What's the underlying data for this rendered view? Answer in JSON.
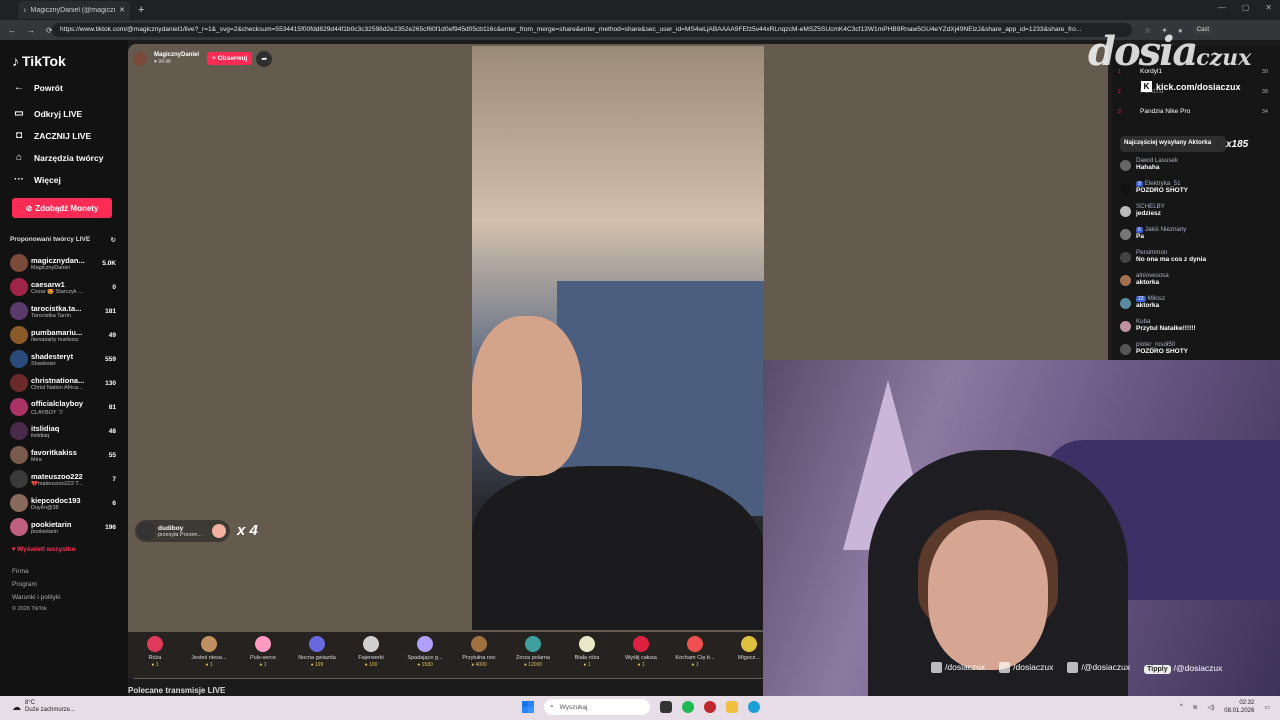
{
  "browser": {
    "tab_title": "MagicznyDaniel (@magiczny...",
    "url": "https://www.tiktok.com/@magicznydaniel1/live?_r=1&_svg=2&checksum=5534415f00fdd829d44f1b0c3c32598d2e2352e265cf60f1d0ef945d05cb116c&enter_from_merge=share&enter_method=share&sec_user_id=MS4wLjABAAAA9FEfz5v44xRLnqzcM-eMSZ5SUcmK4C3cf13W1mPHB9Rnaw5GU4eYZdXj49NElzJ&share_app_id=1233&share_fro...",
    "cast_label": "Cast"
  },
  "sidebar": {
    "logo": "TikTok",
    "back": "Powrót",
    "nav": [
      "Odkryj LIVE",
      "ZACZNIJ LIVE",
      "Narzędzia twórcy",
      "Więcej"
    ],
    "coins_button": "Zdobądź Monety",
    "suggested_title": "Proponowani twórcy LIVE",
    "creators": [
      {
        "name": "magicznydan...",
        "sub": "MagicznyDaniel",
        "count": "5.0K",
        "color": "#7a4a3a"
      },
      {
        "name": "caesarw1",
        "sub": "Cezar 😍 Starczyk ...",
        "count": "0",
        "color": "#a0234a"
      },
      {
        "name": "tarocistka.ta...",
        "sub": "Tarocistka Tarrin",
        "count": "181",
        "color": "#5a3a6a"
      },
      {
        "name": "pumbamariu...",
        "sub": "nienażarty markosz",
        "count": "49",
        "color": "#8a5a2a"
      },
      {
        "name": "shadesteryt",
        "sub": "Shadester",
        "count": "559",
        "color": "#2a4a7a"
      },
      {
        "name": "christnationa...",
        "sub": "Christ Nation Africa...",
        "count": "130",
        "color": "#6a2a2a"
      },
      {
        "name": "officialclayboy",
        "sub": "CLAYBOY ツ",
        "count": "81",
        "color": "#aa3366"
      },
      {
        "name": "itslidiaq",
        "sub": "itslidiaq",
        "count": "48",
        "color": "#4a2a4a"
      },
      {
        "name": "favoritkakiss",
        "sub": "Mira",
        "count": "55",
        "color": "#7a5a4a"
      },
      {
        "name": "mateuszoo222",
        "sub": "💔mateuszoo222 T...",
        "count": "7",
        "color": "#3a3a3a"
      },
      {
        "name": "kiepcodoc193",
        "sub": "Duyên@38",
        "count": "6",
        "color": "#8a6a5a"
      },
      {
        "name": "pookietarin",
        "sub": "pookietarin",
        "count": "196",
        "color": "#c06080"
      }
    ],
    "show_all": "Wyświetl wszystko",
    "footer": [
      "Firma",
      "Program",
      "Warunki i polityki",
      "© 2026 TikTok"
    ]
  },
  "live": {
    "host_name": "MagicznyDaniel",
    "host_likes": "♥ 94.9K",
    "follow_label": "+ Obserwuj",
    "gift_sender": "dudiboy",
    "gift_sub": "przesyła Prezen...",
    "gift_multiplier": "x 4",
    "below_title": "Polecane transmisje LIVE"
  },
  "gifts": [
    {
      "label": "Róża",
      "price": "1",
      "color": "#e03a5a"
    },
    {
      "label": "Jesteś niesa...",
      "price": "1",
      "color": "#c09060"
    },
    {
      "label": "Puls-serce",
      "price": "1",
      "color": "#ff9ac0"
    },
    {
      "label": "Nocna gwiazda",
      "price": "199",
      "color": "#6a6ae0"
    },
    {
      "label": "Fajerwerki",
      "price": "100",
      "color": "#d0d0d0"
    },
    {
      "label": "Spadające g...",
      "price": "1580",
      "color": "#b0a0ff"
    },
    {
      "label": "Przytulna noc",
      "price": "4000",
      "color": "#a07040"
    },
    {
      "label": "Zorza polarna",
      "price": "12000",
      "color": "#40a0a0"
    },
    {
      "label": "Biała róża",
      "price": "1",
      "color": "#e8e8c8"
    },
    {
      "label": "Wyślij całusa",
      "price": "1",
      "color": "#e02040"
    },
    {
      "label": "Kocham Cię b...",
      "price": "1",
      "color": "#f05050"
    },
    {
      "label": "Migocz...",
      "price": "",
      "color": "#e0c040"
    }
  ],
  "chat": {
    "ranks": [
      {
        "num": "1",
        "name": "Kordyl1",
        "count": "39"
      },
      {
        "num": "2",
        "name": "Pandzia",
        "count": "38"
      },
      {
        "num": "3",
        "name": "Pandzia Nike Pro",
        "count": "34"
      }
    ],
    "top_sender_label": "Najczęściej wysyłany Aktorka",
    "top_sender_count": "x185",
    "messages": [
      {
        "user": "Dawid Lasusek",
        "badge": "",
        "text": "Hahaha"
      },
      {
        "user": "Elektryka_51",
        "badge": "9",
        "text": "POZDRO SHOTY"
      },
      {
        "user": "SCHELBY",
        "badge": "",
        "text": "jedziesz"
      },
      {
        "user": "Jakiś Nieznany",
        "badge": "6",
        "text": "Pa"
      },
      {
        "user": "Persimmon",
        "badge": "",
        "text": "No ona ma cos z dynia"
      },
      {
        "user": "alniovesosa",
        "badge": "",
        "text": "aktorka"
      },
      {
        "user": "Miłosz",
        "badge": "23",
        "text": "aktorka"
      },
      {
        "user": "Kuba",
        "badge": "",
        "text": "Przytul Natalke!!!!!!"
      },
      {
        "user": "pioter_rosół50",
        "badge": "",
        "text": "POZDRO SHOTY"
      }
    ]
  },
  "overlay": {
    "logo_text": "dosia",
    "logo_small": "czux",
    "kick": "kick.com/dosiaczux",
    "socials": [
      "/dosiaczux",
      "/dosiaczux",
      "/@dosiaczux"
    ],
    "tipply": "Tipply",
    "tipply_handle": "/@dosiaczux"
  },
  "taskbar": {
    "temp": "8°C",
    "weather": "Duże zachmurze...",
    "search": "Wyszukaj",
    "time": "02:32",
    "date": "08.01.2026"
  }
}
